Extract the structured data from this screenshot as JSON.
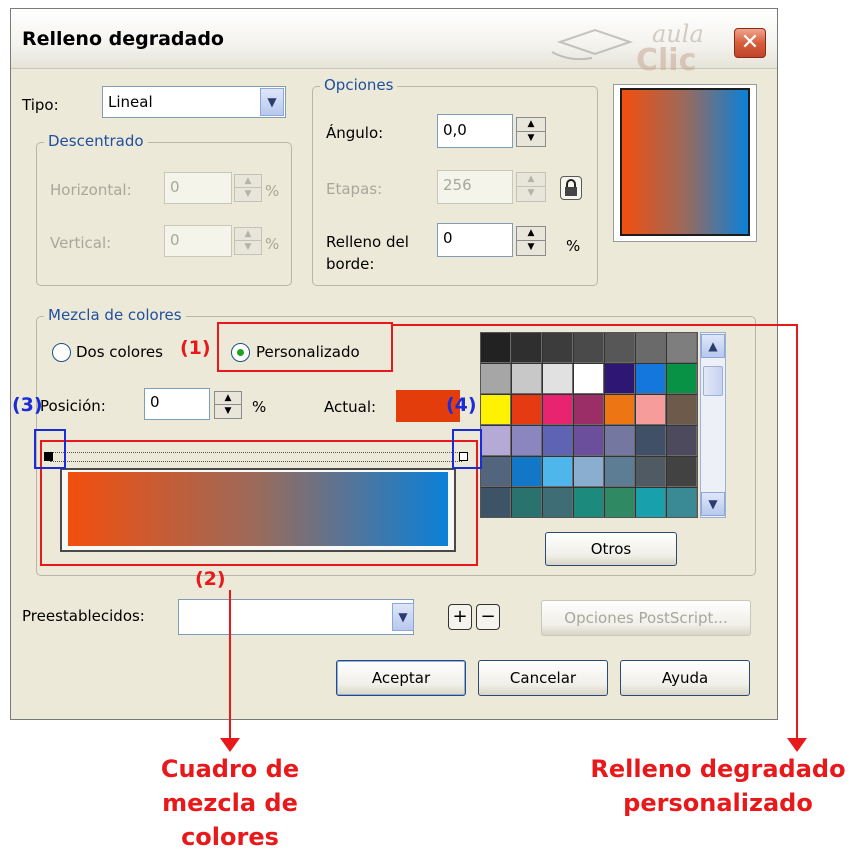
{
  "window": {
    "title": "Relleno degradado",
    "close_glyph": "✕"
  },
  "watermark": {
    "line1": "aula",
    "line2": "Clic"
  },
  "tipo": {
    "label": "Tipo:",
    "value": "Lineal"
  },
  "descentrado": {
    "legend": "Descentrado",
    "horizontal": {
      "label": "Horizontal:",
      "value": "0",
      "unit": "%"
    },
    "vertical": {
      "label": "Vertical:",
      "value": "0",
      "unit": "%"
    }
  },
  "opciones": {
    "legend": "Opciones",
    "angulo": {
      "label": "Ángulo:",
      "value": "0,0"
    },
    "etapas": {
      "label": "Etapas:",
      "value": "256"
    },
    "relleno_borde": {
      "label_line1": "Relleno del",
      "label_line2": "borde:",
      "value": "0",
      "unit": "%"
    }
  },
  "mezcla": {
    "legend": "Mezcla de colores",
    "dos_colores": "Dos colores",
    "personalizado": "Personalizado",
    "posicion": {
      "label": "Posición:",
      "value": "0",
      "unit": "%"
    },
    "actual_label": "Actual:",
    "actual_color": "#e33d0c",
    "gradient_start": "#f24f0e",
    "gradient_end": "#0a80d8",
    "otros_label": "Otros"
  },
  "palette": [
    [
      "#222222",
      "#2f2f2f",
      "#3c3c3c",
      "#4a4a4a",
      "#575757",
      "#6a6a6a",
      "#7e7e7e"
    ],
    [
      "#a6a6a6",
      "#c8c8c8",
      "#e1e1e1",
      "#ffffff",
      "#2d1674",
      "#1477dd",
      "#079245"
    ],
    [
      "#fff200",
      "#e63a12",
      "#e8236f",
      "#9c2e67",
      "#ee7513",
      "#f69d9c",
      "#6e5a4b"
    ],
    [
      "#b5a9d6",
      "#8b86c0",
      "#5f63b3",
      "#6b4f9d",
      "#7478a0",
      "#3f5067",
      "#4d4a5e"
    ],
    [
      "#52657c",
      "#1277c6",
      "#4eb6ea",
      "#8aaed0",
      "#5d7d95",
      "#4f5a62",
      "#424242"
    ],
    [
      "#3c5466",
      "#2a726d",
      "#3f6d75",
      "#1d8a7e",
      "#2f8a64",
      "#18a0ad",
      "#3a8a96"
    ]
  ],
  "preestablecidos": {
    "label": "Preestablecidos:",
    "value": ""
  },
  "postscript_label": "Opciones PostScript...",
  "buttons": {
    "aceptar": "Aceptar",
    "cancelar": "Cancelar",
    "ayuda": "Ayuda"
  },
  "annotations": {
    "n1": "(1)",
    "n2": "(2)",
    "n3": "(3)",
    "n4": "(4)",
    "caption_left_1": "Cuadro de mezcla de",
    "caption_left_2": "colores",
    "caption_right_1": "Relleno degradado",
    "caption_right_2": "personalizado"
  },
  "colors": {
    "annotation_red": "#e8191b",
    "annotation_blue": "#1a2bd9",
    "legend_blue": "#1f4f9e"
  }
}
